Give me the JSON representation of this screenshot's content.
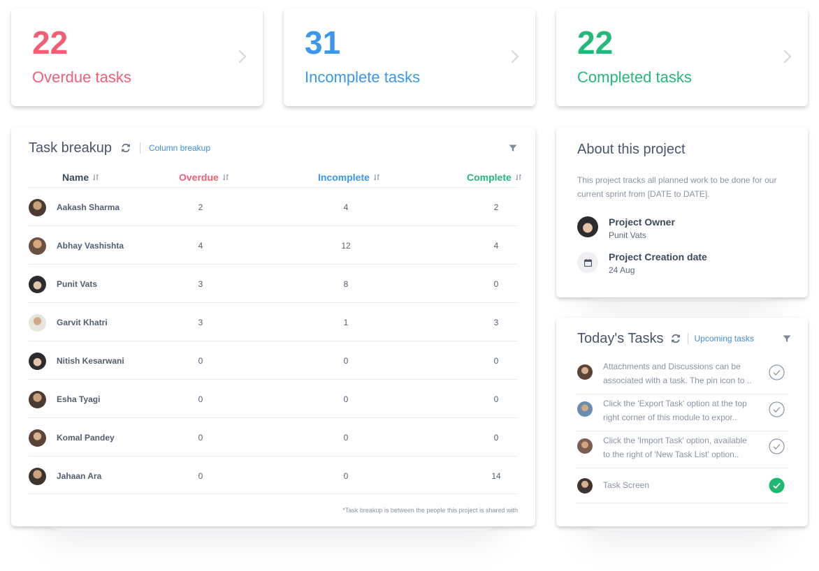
{
  "colors": {
    "overdue": "#f25f74",
    "incomplete": "#3a97ec",
    "complete": "#22b97a"
  },
  "stats": [
    {
      "value": "22",
      "label": "Overdue tasks"
    },
    {
      "value": "31",
      "label": "Incomplete tasks"
    },
    {
      "value": "22",
      "label": "Completed tasks"
    }
  ],
  "breakup": {
    "title": "Task breakup",
    "link": "Column breakup",
    "headers": {
      "name": "Name",
      "overdue": "Overdue",
      "incomplete": "Incomplete",
      "complete": "Complete"
    },
    "rows": [
      {
        "name": "Aakash Sharma",
        "overdue": "2",
        "incomplete": "4",
        "complete": "2"
      },
      {
        "name": "Abhay Vashishta",
        "overdue": "4",
        "incomplete": "12",
        "complete": "4"
      },
      {
        "name": "Punit Vats",
        "overdue": "3",
        "incomplete": "8",
        "complete": "0"
      },
      {
        "name": "Garvit Khatri",
        "overdue": "3",
        "incomplete": "1",
        "complete": "3"
      },
      {
        "name": "Nitish Kesarwani",
        "overdue": "0",
        "incomplete": "0",
        "complete": "0"
      },
      {
        "name": "Esha Tyagi",
        "overdue": "0",
        "incomplete": "0",
        "complete": "0"
      },
      {
        "name": "Komal Pandey",
        "overdue": "0",
        "incomplete": "0",
        "complete": "0"
      },
      {
        "name": "Jahaan Ara",
        "overdue": "0",
        "incomplete": "0",
        "complete": "14"
      }
    ],
    "footnote": "*Task breakup is between the people this project is shared with"
  },
  "about": {
    "title": "About this project",
    "description": "This project tracks all planned work to be done for our current sprint from [DATE to DATE].",
    "owner_label": "Project Owner",
    "owner_name": "Punit Vats",
    "date_label": "Project Creation date",
    "date_value": "24 Aug"
  },
  "today": {
    "title": "Today's Tasks",
    "link": "Upcoming tasks",
    "tasks": [
      {
        "line1": "Attachments and Discussions can be",
        "line2": "associated with a task. The pin icon to ..",
        "done": false
      },
      {
        "line1": "Click the 'Export Task' option at the top",
        "line2": "right corner of this module to expor..",
        "done": false
      },
      {
        "line1": "Click the 'Import Task' option, available",
        "line2": "to the right of 'New Task List' option..",
        "done": false
      },
      {
        "line1": "Task Screen",
        "line2": "",
        "done": true
      }
    ]
  }
}
